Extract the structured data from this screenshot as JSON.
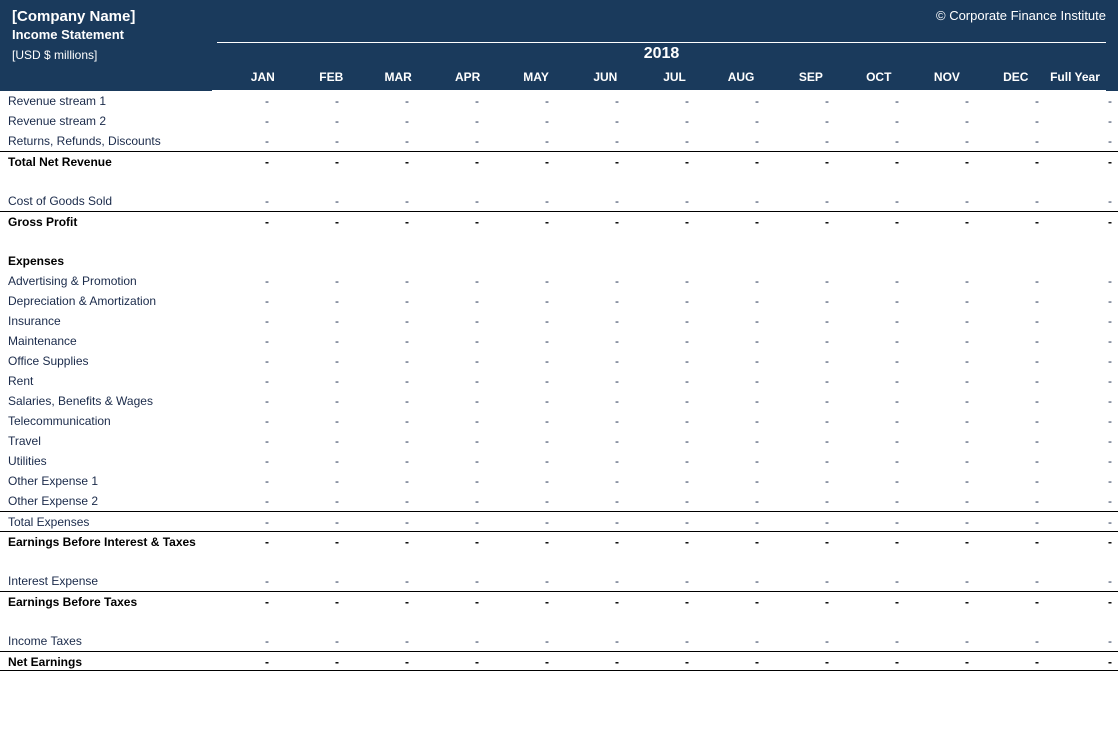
{
  "header": {
    "company_name": "[Company Name]",
    "copyright": "© Corporate Finance Institute",
    "subtitle": "Income Statement",
    "units": "[USD $ millions]",
    "year": "2018",
    "months": [
      "JAN",
      "FEB",
      "MAR",
      "APR",
      "MAY",
      "JUN",
      "JUL",
      "AUG",
      "SEP",
      "OCT",
      "NOV",
      "DEC"
    ],
    "full_year": "Full Year"
  },
  "rows": {
    "rev1": {
      "label": "Revenue stream 1",
      "v": [
        "-",
        "-",
        "-",
        "-",
        "-",
        "-",
        "-",
        "-",
        "-",
        "-",
        "-",
        "-",
        "-"
      ]
    },
    "rev2": {
      "label": "Revenue stream 2",
      "v": [
        "-",
        "-",
        "-",
        "-",
        "-",
        "-",
        "-",
        "-",
        "-",
        "-",
        "-",
        "-",
        "-"
      ]
    },
    "returns": {
      "label": "Returns, Refunds, Discounts",
      "v": [
        "-",
        "-",
        "-",
        "-",
        "-",
        "-",
        "-",
        "-",
        "-",
        "-",
        "-",
        "-",
        "-"
      ]
    },
    "total_net_rev": {
      "label": "Total Net Revenue",
      "v": [
        "-",
        "-",
        "-",
        "-",
        "-",
        "-",
        "-",
        "-",
        "-",
        "-",
        "-",
        "-",
        "-"
      ]
    },
    "cogs": {
      "label": "Cost of Goods Sold",
      "v": [
        "-",
        "-",
        "-",
        "-",
        "-",
        "-",
        "-",
        "-",
        "-",
        "-",
        "-",
        "-",
        "-"
      ]
    },
    "gross_profit": {
      "label": "Gross Profit",
      "v": [
        "-",
        "-",
        "-",
        "-",
        "-",
        "-",
        "-",
        "-",
        "-",
        "-",
        "-",
        "-",
        "-"
      ]
    },
    "expenses_header": {
      "label": "Expenses"
    },
    "adv": {
      "label": "Advertising & Promotion",
      "v": [
        "-",
        "-",
        "-",
        "-",
        "-",
        "-",
        "-",
        "-",
        "-",
        "-",
        "-",
        "-",
        "-"
      ]
    },
    "dep": {
      "label": "Depreciation & Amortization",
      "v": [
        "-",
        "-",
        "-",
        "-",
        "-",
        "-",
        "-",
        "-",
        "-",
        "-",
        "-",
        "-",
        "-"
      ]
    },
    "ins": {
      "label": "Insurance",
      "v": [
        "-",
        "-",
        "-",
        "-",
        "-",
        "-",
        "-",
        "-",
        "-",
        "-",
        "-",
        "-",
        "-"
      ]
    },
    "maint": {
      "label": "Maintenance",
      "v": [
        "-",
        "-",
        "-",
        "-",
        "-",
        "-",
        "-",
        "-",
        "-",
        "-",
        "-",
        "-",
        "-"
      ]
    },
    "office": {
      "label": "Office Supplies",
      "v": [
        "-",
        "-",
        "-",
        "-",
        "-",
        "-",
        "-",
        "-",
        "-",
        "-",
        "-",
        "-",
        "-"
      ]
    },
    "rent": {
      "label": "Rent",
      "v": [
        "-",
        "-",
        "-",
        "-",
        "-",
        "-",
        "-",
        "-",
        "-",
        "-",
        "-",
        "-",
        "-"
      ]
    },
    "sal": {
      "label": "Salaries, Benefits & Wages",
      "v": [
        "-",
        "-",
        "-",
        "-",
        "-",
        "-",
        "-",
        "-",
        "-",
        "-",
        "-",
        "-",
        "-"
      ]
    },
    "tel": {
      "label": "Telecommunication",
      "v": [
        "-",
        "-",
        "-",
        "-",
        "-",
        "-",
        "-",
        "-",
        "-",
        "-",
        "-",
        "-",
        "-"
      ]
    },
    "travel": {
      "label": "Travel",
      "v": [
        "-",
        "-",
        "-",
        "-",
        "-",
        "-",
        "-",
        "-",
        "-",
        "-",
        "-",
        "-",
        "-"
      ]
    },
    "util": {
      "label": "Utilities",
      "v": [
        "-",
        "-",
        "-",
        "-",
        "-",
        "-",
        "-",
        "-",
        "-",
        "-",
        "-",
        "-",
        "-"
      ]
    },
    "oth1": {
      "label": "Other Expense 1",
      "v": [
        "-",
        "-",
        "-",
        "-",
        "-",
        "-",
        "-",
        "-",
        "-",
        "-",
        "-",
        "-",
        "-"
      ]
    },
    "oth2": {
      "label": "Other Expense 2",
      "v": [
        "-",
        "-",
        "-",
        "-",
        "-",
        "-",
        "-",
        "-",
        "-",
        "-",
        "-",
        "-",
        "-"
      ]
    },
    "total_exp": {
      "label": "Total Expenses",
      "v": [
        "-",
        "-",
        "-",
        "-",
        "-",
        "-",
        "-",
        "-",
        "-",
        "-",
        "-",
        "-",
        "-"
      ]
    },
    "ebit": {
      "label": "Earnings Before Interest & Taxes",
      "v": [
        "-",
        "-",
        "-",
        "-",
        "-",
        "-",
        "-",
        "-",
        "-",
        "-",
        "-",
        "-",
        "-"
      ]
    },
    "int_exp": {
      "label": "Interest Expense",
      "v": [
        "-",
        "-",
        "-",
        "-",
        "-",
        "-",
        "-",
        "-",
        "-",
        "-",
        "-",
        "-",
        "-"
      ]
    },
    "ebt": {
      "label": "Earnings Before Taxes",
      "v": [
        "-",
        "-",
        "-",
        "-",
        "-",
        "-",
        "-",
        "-",
        "-",
        "-",
        "-",
        "-",
        "-"
      ]
    },
    "tax": {
      "label": "Income Taxes",
      "v": [
        "-",
        "-",
        "-",
        "-",
        "-",
        "-",
        "-",
        "-",
        "-",
        "-",
        "-",
        "-",
        "-"
      ]
    },
    "net": {
      "label": "Net Earnings",
      "v": [
        "-",
        "-",
        "-",
        "-",
        "-",
        "-",
        "-",
        "-",
        "-",
        "-",
        "-",
        "-",
        "-"
      ]
    }
  }
}
